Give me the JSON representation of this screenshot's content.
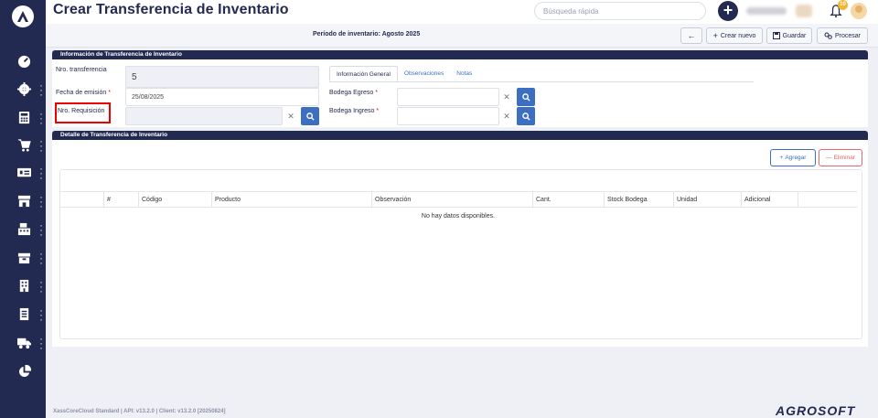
{
  "header": {
    "title": "Crear Transferencia de Inventario",
    "search_placeholder": "Búsqueda rápida",
    "notification_count": "10"
  },
  "period_bar": {
    "period_label": "Período de inventario: Agosto 2025",
    "buttons": {
      "back": "←",
      "new": "Crear nuevo",
      "save": "Guardar",
      "process": "Procesar"
    }
  },
  "info_panel": {
    "header": "Información de Transferencia de Inventario",
    "fields": {
      "transfer_no_label": "Nro. transferencia",
      "transfer_no_value": "5",
      "issue_date_label": "Fecha de emisión",
      "issue_date_value": "25/08/2025",
      "requisition_label": "Nro. Requisición",
      "requisition_value": "",
      "origin_label": "Bodega Egreso",
      "destination_label": "Bodega Ingreso",
      "required_mark": "*"
    },
    "tabs": [
      "Información General",
      "Observaciones",
      "Notas"
    ]
  },
  "detail_panel": {
    "header": "Detalle de Transferencia de Inventario",
    "add_button": "Agregar",
    "delete_button": "Eliminar",
    "columns": [
      "#",
      "Código",
      "Producto",
      "Observación",
      "Cant.",
      "Stock Bodega",
      "Unidad",
      "Adicional"
    ],
    "empty_message": "No hay datos disponibles."
  },
  "sidebar": {
    "items": [
      {
        "icon": "dashboard-icon"
      },
      {
        "icon": "gear-icon"
      },
      {
        "icon": "calculator-icon"
      },
      {
        "icon": "cart-icon"
      },
      {
        "icon": "money-icon"
      },
      {
        "icon": "store-icon"
      },
      {
        "icon": "cash-register-icon"
      },
      {
        "icon": "box-icon"
      },
      {
        "icon": "building-icon"
      },
      {
        "icon": "document-icon"
      },
      {
        "icon": "truck-icon"
      },
      {
        "icon": "pie-chart-icon"
      }
    ]
  },
  "footer": {
    "version": "XassCoreCloud Standard | API: v13.2.0 | Client: v13.2.0 [20250824]",
    "brand": "AGROSOFT"
  },
  "colors": {
    "navy": "#232a52",
    "accent_blue": "#3d6fc1",
    "danger": "#e26a6a",
    "highlight_red": "#e00000"
  }
}
